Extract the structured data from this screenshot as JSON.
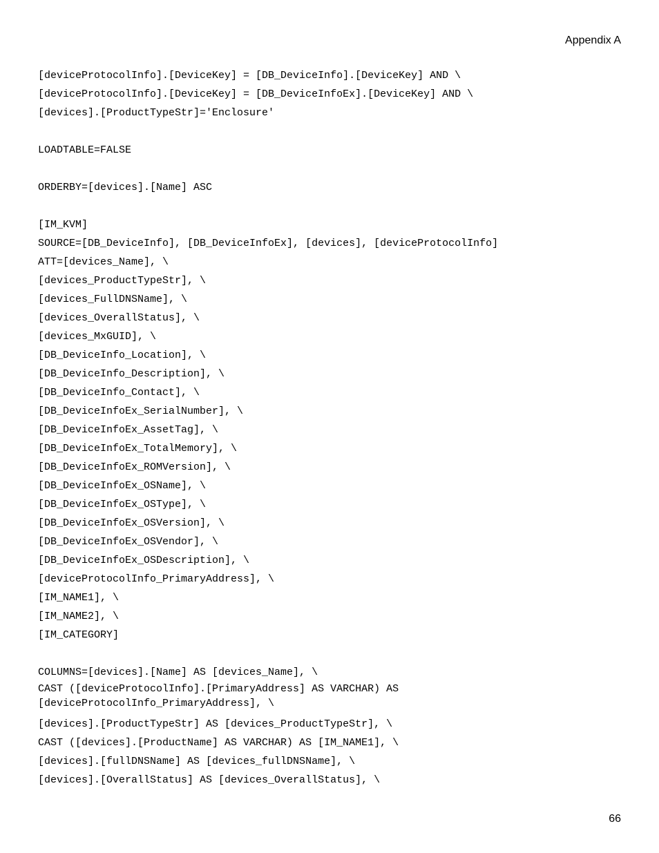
{
  "header": "Appendix A",
  "footer": "66",
  "lines": [
    "[deviceProtocolInfo].[DeviceKey] = [DB_DeviceInfo].[DeviceKey] AND \\",
    "[deviceProtocolInfo].[DeviceKey] = [DB_DeviceInfoEx].[DeviceKey] AND \\",
    "[devices].[ProductTypeStr]='Enclosure'",
    "",
    "LOADTABLE=FALSE",
    "",
    "ORDERBY=[devices].[Name] ASC",
    "",
    "[IM_KVM]",
    "SOURCE=[DB_DeviceInfo], [DB_DeviceInfoEx], [devices], [deviceProtocolInfo]",
    "ATT=[devices_Name], \\",
    "[devices_ProductTypeStr], \\",
    "[devices_FullDNSName], \\",
    "[devices_OverallStatus], \\",
    "[devices_MxGUID], \\",
    "[DB_DeviceInfo_Location], \\",
    "[DB_DeviceInfo_Description], \\",
    "[DB_DeviceInfo_Contact], \\",
    "[DB_DeviceInfoEx_SerialNumber], \\",
    "[DB_DeviceInfoEx_AssetTag], \\",
    "[DB_DeviceInfoEx_TotalMemory], \\",
    "[DB_DeviceInfoEx_ROMVersion], \\",
    "[DB_DeviceInfoEx_OSName], \\",
    "[DB_DeviceInfoEx_OSType], \\",
    "[DB_DeviceInfoEx_OSVersion], \\",
    "[DB_DeviceInfoEx_OSVendor], \\",
    "[DB_DeviceInfoEx_OSDescription], \\",
    "[deviceProtocolInfo_PrimaryAddress], \\",
    "[IM_NAME1], \\",
    "[IM_NAME2], \\",
    "[IM_CATEGORY]",
    "",
    "COLUMNS=[devices].[Name] AS [devices_Name], \\",
    "CAST ([deviceProtocolInfo].[PrimaryAddress] AS VARCHAR) AS [deviceProtocolInfo_PrimaryAddress], \\",
    "[devices].[ProductTypeStr] AS [devices_ProductTypeStr], \\",
    "CAST ([devices].[ProductName] AS VARCHAR) AS [IM_NAME1], \\",
    "[devices].[fullDNSName] AS [devices_fullDNSName], \\",
    "[devices].[OverallStatus] AS [devices_OverallStatus], \\"
  ]
}
